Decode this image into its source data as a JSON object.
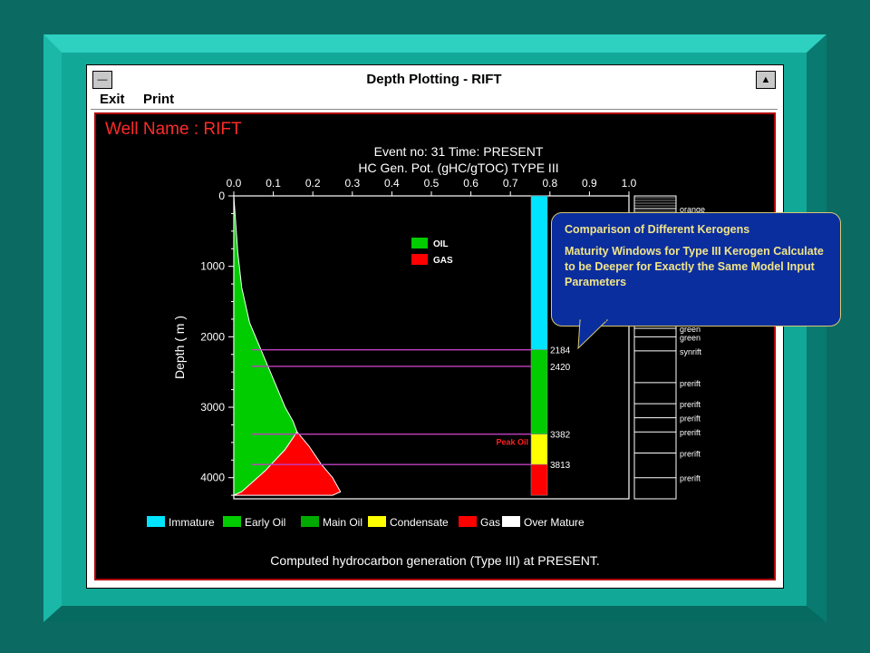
{
  "window": {
    "title": "Depth Plotting - RIFT",
    "menu": [
      "Exit",
      "Print"
    ],
    "minimize_glyph": "▲",
    "sysmenu_glyph": "—"
  },
  "well_name": "Well Name : RIFT",
  "caption": "Computed hydrocarbon generation (Type III) at PRESENT.",
  "callout": {
    "title": "Comparison of Different Kerogens",
    "body": "Maturity Windows for Type III Kerogen Calculate to be Deeper for Exactly the Same Model Input Parameters"
  },
  "colors": {
    "teal_outer": "#0b6b62",
    "teal_bevel": "#12a898",
    "plot_bg": "#000000",
    "oil": "#00cc00",
    "gas": "#ff0000",
    "immature": "#00e5ff",
    "early_oil": "#00cc00",
    "condensate": "#ffff00",
    "well_name": "#ff2a2a",
    "callout_bg": "#0b2e9e",
    "callout_text": "#f0e48a"
  },
  "chart_data": {
    "type": "area",
    "title": "Event no: 31  Time: PRESENT",
    "subtitle": "HC Gen. Pot. (gHC/gTOC) TYPE III",
    "ylabel": "Depth ( m )",
    "xlim": [
      0.0,
      1.0
    ],
    "ylim": [
      0,
      4300
    ],
    "x_ticks": [
      "0.0",
      "0.1",
      "0.2",
      "0.3",
      "0.4",
      "0.5",
      "0.6",
      "0.7",
      "0.8",
      "0.9",
      "1.0"
    ],
    "y_ticks": [
      0,
      1000,
      2000,
      3000,
      4000
    ],
    "legend": [
      "OIL",
      "GAS"
    ],
    "series": [
      {
        "name": "OIL",
        "points": [
          [
            0,
            0
          ],
          [
            0.01,
            800
          ],
          [
            0.02,
            1300
          ],
          [
            0.04,
            1800
          ],
          [
            0.07,
            2200
          ],
          [
            0.1,
            2600
          ],
          [
            0.13,
            3000
          ],
          [
            0.15,
            3200
          ],
          [
            0.16,
            3350
          ],
          [
            0.13,
            3600
          ],
          [
            0.08,
            3900
          ],
          [
            0.02,
            4200
          ],
          [
            0.0,
            4250
          ]
        ]
      },
      {
        "name": "GAS",
        "points": [
          [
            0,
            4250
          ],
          [
            0.02,
            4200
          ],
          [
            0.08,
            3900
          ],
          [
            0.13,
            3600
          ],
          [
            0.16,
            3350
          ],
          [
            0.19,
            3550
          ],
          [
            0.22,
            3800
          ],
          [
            0.25,
            4000
          ],
          [
            0.27,
            4200
          ],
          [
            0.25,
            4250
          ]
        ]
      }
    ],
    "depth_markers": [
      {
        "depth": 2184,
        "label": "2184"
      },
      {
        "depth": 2420,
        "label": "2420"
      },
      {
        "depth": 3382,
        "label": "3382"
      },
      {
        "depth": 3813,
        "label": "3813"
      }
    ],
    "peak_oil_label": "Peak Oil",
    "maturity_column": [
      {
        "zone": "Immature",
        "from": 0,
        "to": 2184,
        "color": "#00e5ff"
      },
      {
        "zone": "Main Oil",
        "from": 2184,
        "to": 3382,
        "color": "#00cc00"
      },
      {
        "zone": "Condensate",
        "from": 3382,
        "to": 3813,
        "color": "#ffff00"
      },
      {
        "zone": "Gas",
        "from": 3813,
        "to": 4250,
        "color": "#ff0000"
      }
    ],
    "maturity_legend": [
      {
        "label": "Immature",
        "color": "#00e5ff"
      },
      {
        "label": "Early Oil",
        "color": "#00cc00"
      },
      {
        "label": "Main Oil",
        "color": "#00aa00"
      },
      {
        "label": "Condensate",
        "color": "#ffff00"
      },
      {
        "label": "Gas",
        "color": "#ff0000"
      },
      {
        "label": "Over Mature",
        "color": "#ffffff"
      }
    ],
    "stratigraphy": [
      {
        "label": "orange",
        "depth": 180
      },
      {
        "label": "green",
        "depth": 1880
      },
      {
        "label": "green",
        "depth": 2000
      },
      {
        "label": "synrift",
        "depth": 2200
      },
      {
        "label": "prerift",
        "depth": 2650
      },
      {
        "label": "prerift",
        "depth": 2950
      },
      {
        "label": "prerift",
        "depth": 3150
      },
      {
        "label": "prerift",
        "depth": 3350
      },
      {
        "label": "prerift",
        "depth": 3650
      },
      {
        "label": "prerift",
        "depth": 4000
      }
    ]
  }
}
